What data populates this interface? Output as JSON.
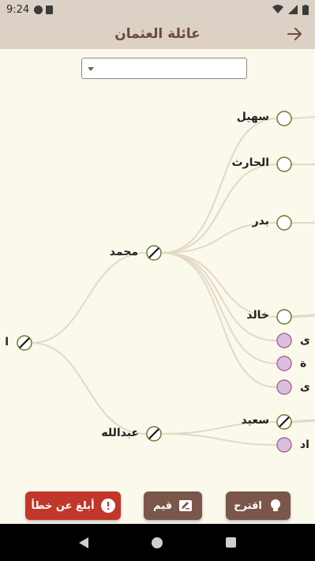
{
  "status_bar": {
    "time": "9:24"
  },
  "app_bar": {
    "title": "عائلة العثمان"
  },
  "dropdown": {
    "value": ""
  },
  "tree": {
    "root": {
      "label": "ا",
      "status": "unknown"
    },
    "children": [
      {
        "label": "محمد",
        "status": "unknown"
      },
      {
        "label": "عبدالله",
        "status": "unknown"
      }
    ],
    "grandchildren_mohammed": [
      {
        "label": "سهيل",
        "gender": "male"
      },
      {
        "label": "الحارث",
        "gender": "male"
      },
      {
        "label": "بدر",
        "gender": "male"
      },
      {
        "label": "خالد",
        "gender": "male"
      },
      {
        "label": "ى",
        "gender": "female"
      },
      {
        "label": "ة",
        "gender": "female"
      },
      {
        "label": "ى",
        "gender": "female"
      }
    ],
    "grandchildren_abdullah": [
      {
        "label": "سعيد",
        "status": "unknown"
      },
      {
        "label": "اد",
        "gender": "female"
      }
    ]
  },
  "buttons": {
    "report": "أبلغ عن خطأ",
    "rate": "قيم",
    "suggest": "اقترح"
  },
  "colors": {
    "male": "#6c7a2a",
    "female": "#a86aa0",
    "female_fill": "#dbbfdc",
    "report": "#c1382a",
    "secondary": "#7a564b"
  }
}
